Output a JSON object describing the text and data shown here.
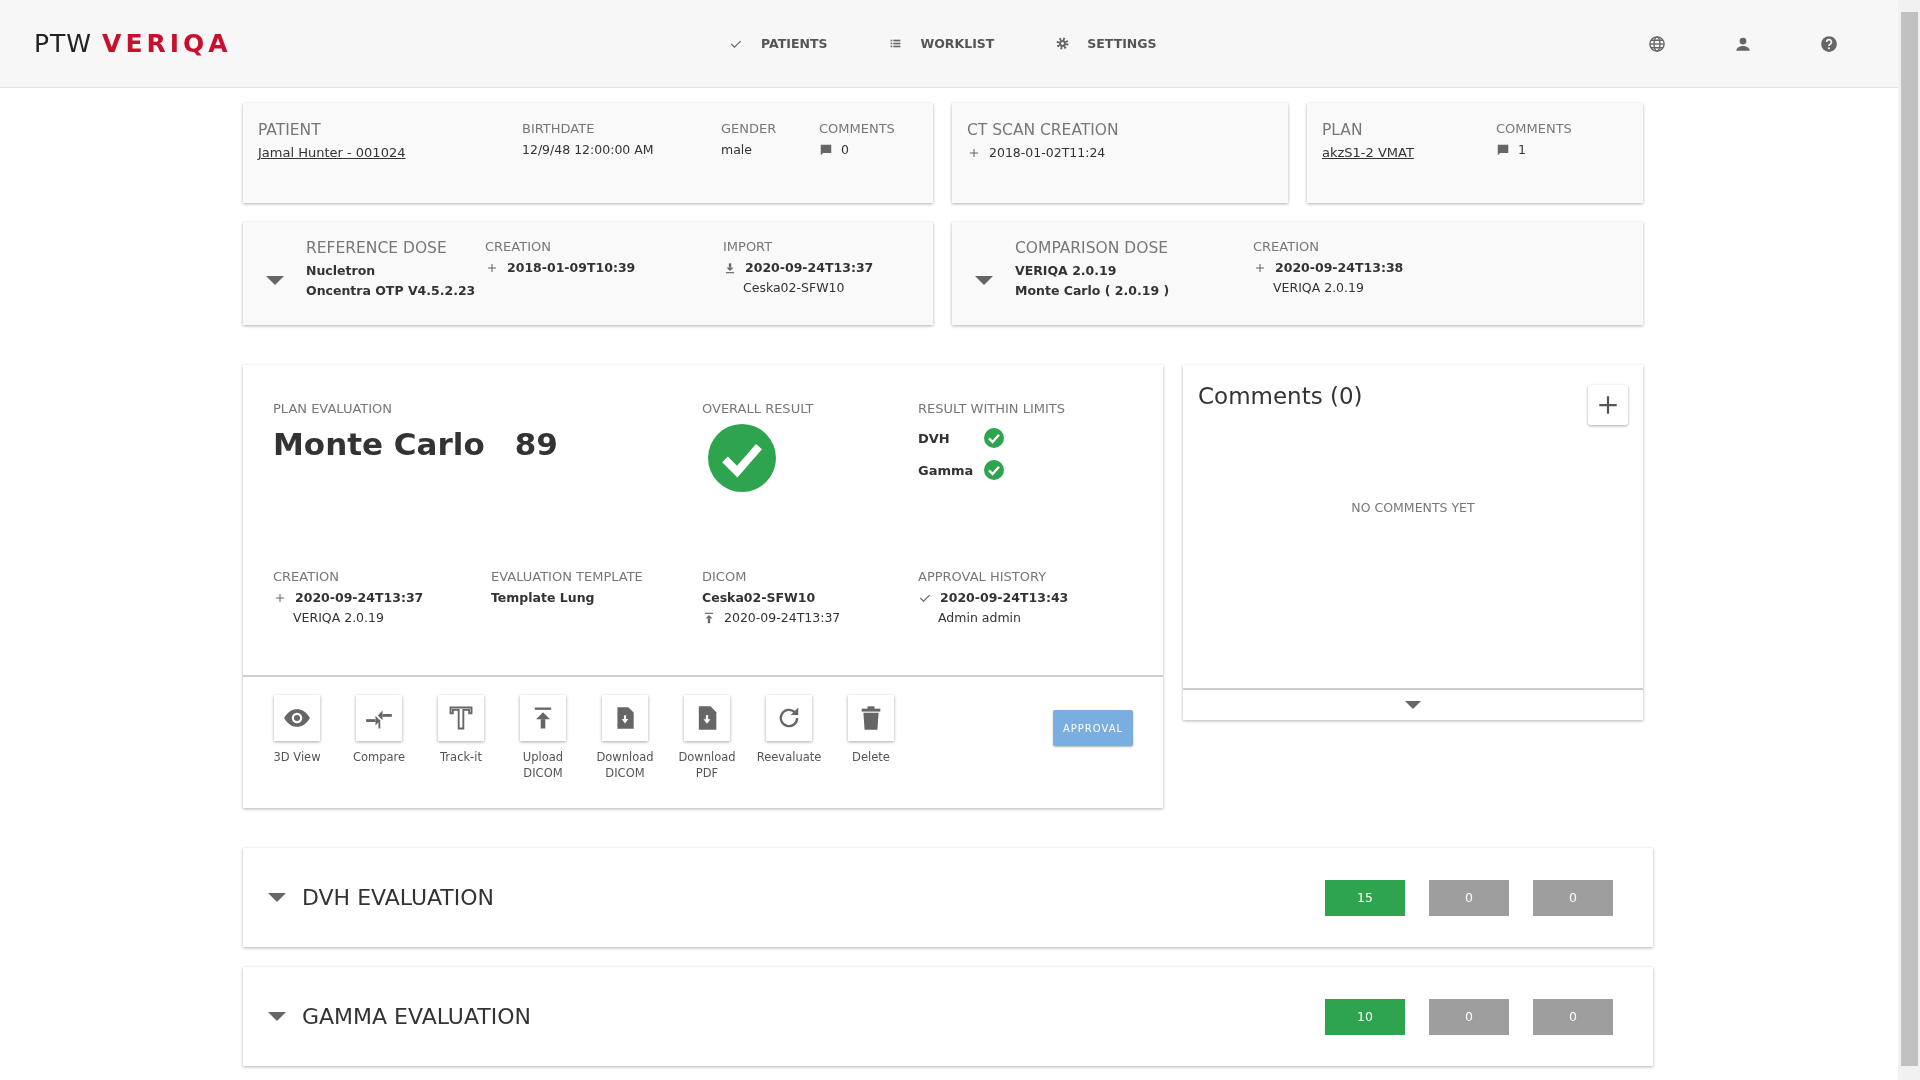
{
  "header": {
    "logo": {
      "mark": "PTW",
      "brand": "VERIQA"
    },
    "nav": [
      {
        "label": "PATIENTS",
        "kind": "check"
      },
      {
        "label": "WORKLIST",
        "kind": "list"
      },
      {
        "label": "SETTINGS",
        "kind": "gear"
      }
    ],
    "tools": [
      {
        "kind": "globe"
      },
      {
        "kind": "user"
      },
      {
        "kind": "help"
      }
    ]
  },
  "top_cards": [
    {
      "columns": [
        {
          "kind": "main",
          "label": "PATIENT",
          "lines": [
            {
              "kind": "link",
              "text": "Jamal Hunter - 001024"
            }
          ]
        },
        {
          "kind": "detail",
          "label": "BIRTHDATE",
          "lines": [
            {
              "kind": "value",
              "text": "12/9/48 12:00:00 AM"
            }
          ]
        },
        {
          "kind": "detail",
          "label": "GENDER",
          "lines": [
            {
              "kind": "value",
              "text": "male"
            }
          ]
        },
        {
          "kind": "detail",
          "label": "COMMENTS",
          "lines": [
            {
              "kind": "comment",
              "text": "0"
            }
          ]
        }
      ]
    },
    {
      "columns": [
        {
          "kind": "main",
          "label": "CT SCAN CREATION",
          "lines": [
            {
              "kind": "stamp",
              "text": "2018-01-02T11:24"
            }
          ]
        }
      ]
    },
    {
      "columns": [
        {
          "kind": "main",
          "label": "PLAN",
          "lines": [
            {
              "kind": "link",
              "text": "akzS1-2 VMAT"
            }
          ]
        },
        {
          "kind": "detail",
          "label": "COMMENTS",
          "lines": [
            {
              "kind": "comment",
              "text": "1"
            }
          ]
        }
      ]
    }
  ],
  "dose_cards": [
    {
      "columns": [
        {
          "kind": "main",
          "label": "REFERENCE DOSE",
          "lines": [
            {
              "kind": "bold",
              "text": "Nucletron"
            },
            {
              "kind": "bold",
              "text": "Oncentra OTP V4.5.2.23"
            }
          ]
        },
        {
          "kind": "detail",
          "label": "CREATION",
          "lines": [
            {
              "kind": "created",
              "text": "2018-01-09T10:39"
            }
          ]
        },
        {
          "kind": "detail",
          "label": "IMPORT",
          "lines": [
            {
              "kind": "imported",
              "text": "2020-09-24T13:37"
            },
            {
              "kind": "sub",
              "text": "Ceska02-SFW10"
            }
          ]
        }
      ]
    },
    {
      "columns": [
        {
          "kind": "main",
          "label": "COMPARISON DOSE",
          "lines": [
            {
              "kind": "bold",
              "text": "VERIQA 2.0.19"
            },
            {
              "kind": "bold",
              "text": "Monte Carlo ( 2.0.19 )"
            }
          ]
        },
        {
          "kind": "detail",
          "label": "CREATION",
          "lines": [
            {
              "kind": "created",
              "text": "2020-09-24T13:38"
            },
            {
              "kind": "sub",
              "text": "VERIQA 2.0.19"
            }
          ]
        }
      ]
    }
  ],
  "plan_evaluation": {
    "label": "PLAN EVALUATION",
    "name": "Monte Carlo",
    "score": "89",
    "overall": {
      "label": "OVERALL RESULT",
      "passed": true
    },
    "limits": {
      "label": "RESULT WITHIN LIMITS",
      "items": [
        {
          "label": "DVH",
          "passed": true
        },
        {
          "label": "Gamma",
          "passed": true
        }
      ]
    },
    "details": [
      {
        "label": "CREATION",
        "lines": [
          {
            "kind": "created",
            "text": "2020-09-24T13:37"
          },
          {
            "kind": "sub",
            "text": "VERIQA 2.0.19"
          }
        ]
      },
      {
        "label": "EVALUATION TEMPLATE",
        "lines": [
          {
            "kind": "bold",
            "text": "Template Lung"
          }
        ]
      },
      {
        "label": "DICOM",
        "lines": [
          {
            "kind": "bold",
            "text": "Ceska02-SFW10"
          },
          {
            "kind": "uploaded",
            "text": "2020-09-24T13:37"
          }
        ]
      },
      {
        "label": "APPROVAL HISTORY",
        "lines": [
          {
            "kind": "approved",
            "text": "2020-09-24T13:43"
          },
          {
            "kind": "sub",
            "text": "Admin admin"
          }
        ]
      }
    ],
    "actions": [
      {
        "kind": "view",
        "label": "3D View"
      },
      {
        "kind": "compare",
        "label": "Compare"
      },
      {
        "kind": "track",
        "label": "Track-it"
      },
      {
        "kind": "upload",
        "label": "Upload\nDICOM"
      },
      {
        "kind": "download",
        "label": "Download\nDICOM"
      },
      {
        "kind": "pdf",
        "label": "Download\nPDF"
      },
      {
        "kind": "reevaluate",
        "label": "Reevaluate"
      },
      {
        "kind": "delete",
        "label": "Delete"
      }
    ],
    "approval_button": "APPROVAL"
  },
  "comments": {
    "title": "Comments (0)",
    "empty": "NO COMMENTS YET"
  },
  "evaluations": [
    {
      "title": "DVH EVALUATION",
      "badges": [
        {
          "text": "15",
          "color": "#2ea44f"
        },
        {
          "text": "0",
          "color": "#9e9e9e"
        },
        {
          "text": "0",
          "color": "#9e9e9e"
        }
      ]
    },
    {
      "title": "GAMMA EVALUATION",
      "badges": [
        {
          "text": "10",
          "color": "#2ea44f"
        },
        {
          "text": "0",
          "color": "#9e9e9e"
        },
        {
          "text": "0",
          "color": "#9e9e9e"
        }
      ]
    }
  ]
}
